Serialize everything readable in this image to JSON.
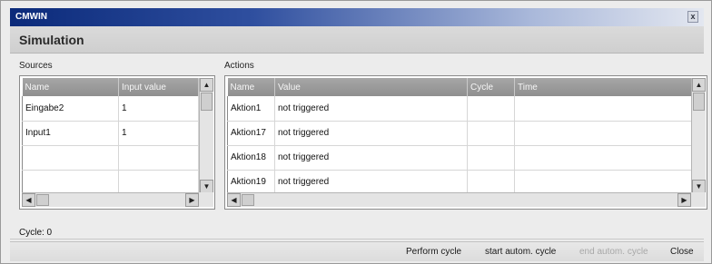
{
  "window": {
    "title": "CMWIN",
    "close_glyph": "x"
  },
  "panel_title": "Simulation",
  "sources": {
    "label": "Sources",
    "columns": [
      "Name",
      "Input value"
    ],
    "rows": [
      [
        "Eingabe2",
        "1"
      ],
      [
        "Input1",
        "1"
      ],
      [
        "",
        ""
      ],
      [
        "",
        ""
      ]
    ]
  },
  "actions": {
    "label": "Actions",
    "columns": [
      "Name",
      "Value",
      "Cycle",
      "Time"
    ],
    "rows": [
      [
        "Aktion1",
        "not triggered",
        "",
        ""
      ],
      [
        "Aktion17",
        "not triggered",
        "",
        ""
      ],
      [
        "Aktion18",
        "not triggered",
        "",
        ""
      ],
      [
        "Aktion19",
        "not triggered",
        "",
        ""
      ]
    ]
  },
  "cycle_status": "Cycle: 0",
  "buttons": {
    "perform_cycle": "Perform cycle",
    "start_autom_cycle": "start autom. cycle",
    "end_autom_cycle": "end autom. cycle",
    "close": "Close"
  },
  "icons": {
    "scroll_up": "▲",
    "scroll_down": "▼",
    "scroll_left": "◀",
    "scroll_right": "▶"
  }
}
